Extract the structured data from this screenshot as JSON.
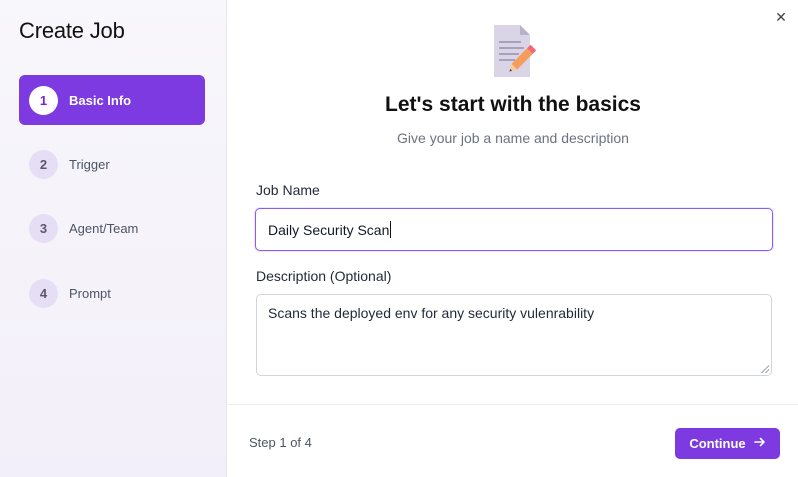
{
  "sidebar": {
    "title": "Create Job",
    "steps": [
      {
        "number": "1",
        "label": "Basic Info",
        "active": true
      },
      {
        "number": "2",
        "label": "Trigger",
        "active": false
      },
      {
        "number": "3",
        "label": "Agent/Team",
        "active": false
      },
      {
        "number": "4",
        "label": "Prompt",
        "active": false
      }
    ]
  },
  "header": {
    "icon": "document-pencil-icon",
    "title": "Let's start with the basics",
    "subtitle": "Give your job a name and description"
  },
  "form": {
    "job_name_label": "Job Name",
    "job_name_value": "Daily Security Scan",
    "description_label": "Description (Optional)",
    "description_value": "Scans the deployed env for any security vulenrability"
  },
  "footer": {
    "step_indicator": "Step 1 of 4",
    "continue_label": "Continue"
  },
  "colors": {
    "accent": "#7c3ae0",
    "focus_border": "#8b5cf6"
  }
}
